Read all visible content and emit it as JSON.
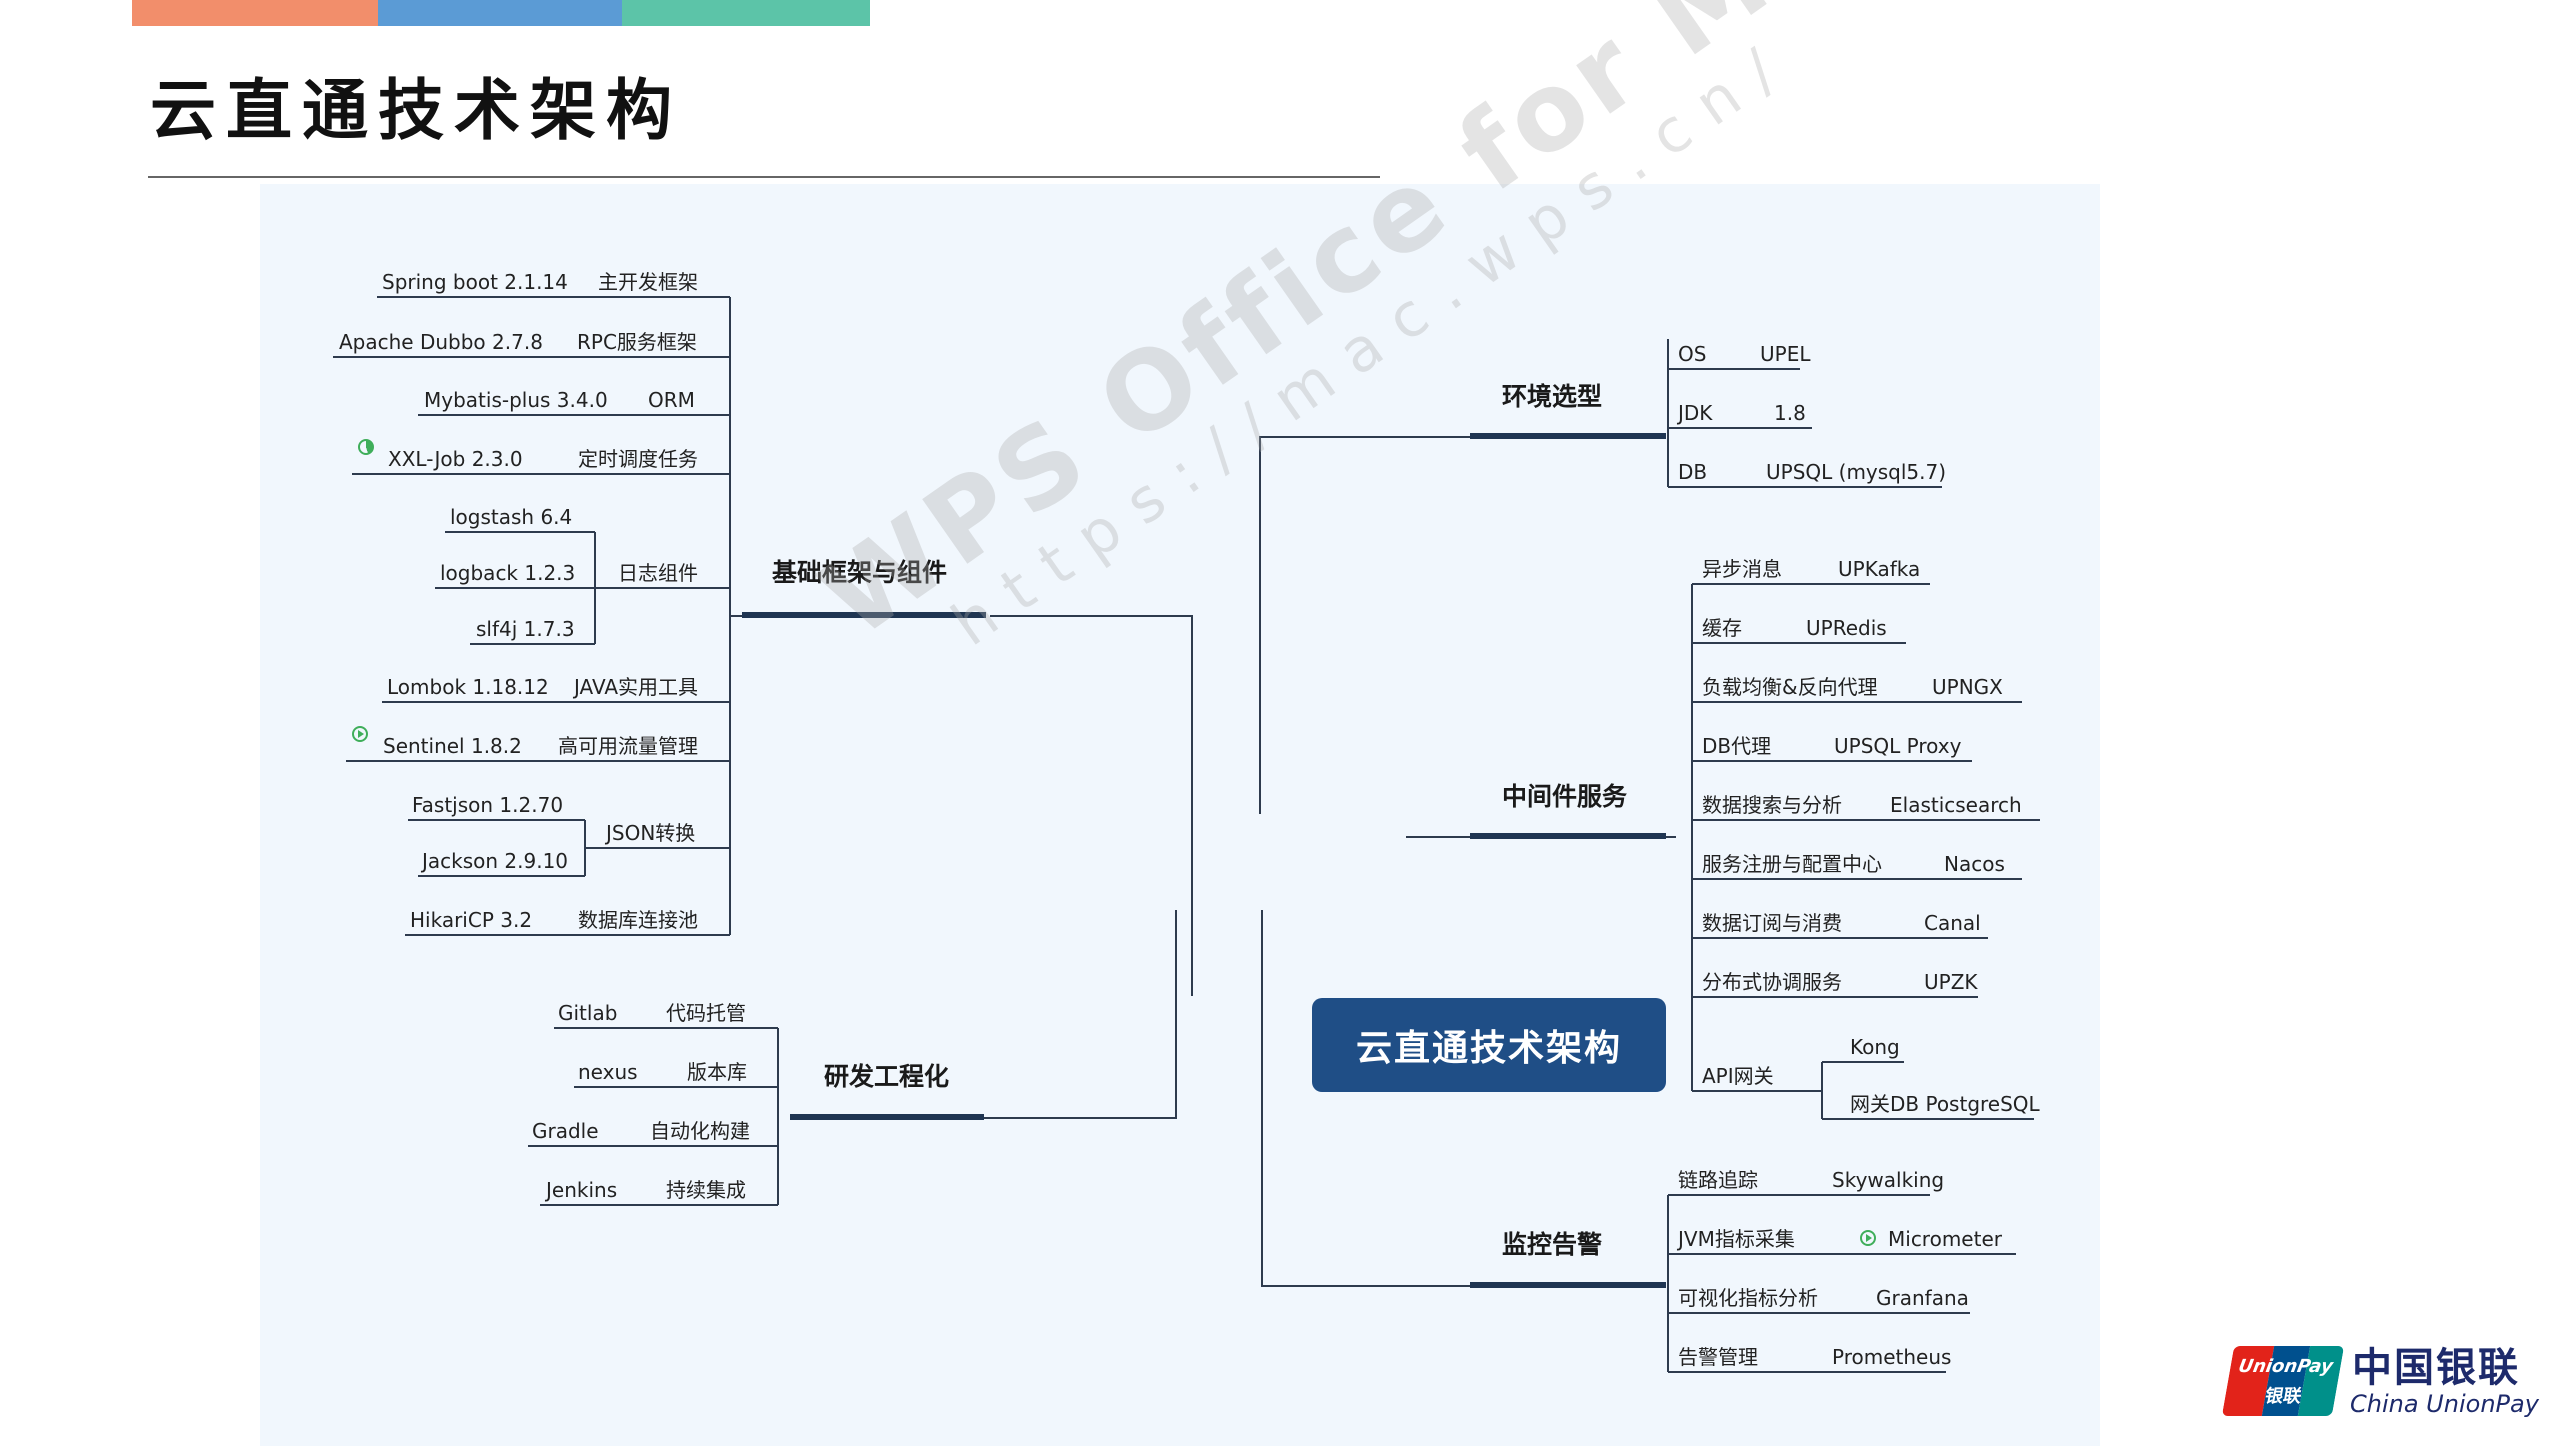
{
  "slide": {
    "title": "云直通技术架构",
    "accent_colors": [
      "#f28e6b",
      "#5b9bd5",
      "#5cc4a8"
    ]
  },
  "mindmap": {
    "center": "云直通技术架构",
    "branches": {
      "base": {
        "label": "基础框架与组件",
        "items": [
          {
            "name": "Spring boot 2.1.14",
            "desc": "主开发框架"
          },
          {
            "name": "Apache Dubbo 2.7.8",
            "desc": "RPC服务框架"
          },
          {
            "name": "Mybatis-plus 3.4.0",
            "desc": "ORM"
          },
          {
            "name": "XXL-Job 2.3.0",
            "desc": "定时调度任务",
            "icon": "progress-icon"
          },
          {
            "name": "Lombok 1.18.12",
            "desc": "JAVA实用工具"
          },
          {
            "name": "Sentinel 1.8.2",
            "desc": "高可用流量管理",
            "icon": "play-icon"
          },
          {
            "name": "HikariCP 3.2",
            "desc": "数据库连接池"
          }
        ],
        "log_group": {
          "label": "日志组件",
          "items": [
            "logstash 6.4",
            "logback 1.2.3",
            "slf4j 1.7.3"
          ]
        },
        "json_group": {
          "label": "JSON转换",
          "items": [
            "Fastjson 1.2.70",
            "Jackson 2.9.10"
          ]
        }
      },
      "devops": {
        "label": "研发工程化",
        "items": [
          {
            "name": "Gitlab",
            "desc": "代码托管"
          },
          {
            "name": "nexus",
            "desc": "版本库"
          },
          {
            "name": "Gradle",
            "desc": "自动化构建"
          },
          {
            "name": "Jenkins",
            "desc": "持续集成"
          }
        ]
      },
      "env": {
        "label": "环境选型",
        "items": [
          {
            "key": "OS",
            "value": "UPEL"
          },
          {
            "key": "JDK",
            "value": "1.8"
          },
          {
            "key": "DB",
            "value": "UPSQL (mysql5.7)"
          }
        ]
      },
      "middleware": {
        "label": "中间件服务",
        "items": [
          {
            "key": "异步消息",
            "value": "UPKafka"
          },
          {
            "key": "缓存",
            "value": "UPRedis"
          },
          {
            "key": "负载均衡&反向代理",
            "value": "UPNGX"
          },
          {
            "key": "DB代理",
            "value": "UPSQL Proxy"
          },
          {
            "key": "数据搜索与分析",
            "value": "Elasticsearch"
          },
          {
            "key": "服务注册与配置中心",
            "value": "Nacos"
          },
          {
            "key": "数据订阅与消费",
            "value": "Canal"
          },
          {
            "key": "分布式协调服务",
            "value": "UPZK"
          }
        ],
        "api_group": {
          "label": "API网关",
          "items": [
            "Kong",
            "网关DB PostgreSQL"
          ]
        }
      },
      "monitor": {
        "label": "监控告警",
        "items": [
          {
            "key": "链路追踪",
            "value": "Skywalking"
          },
          {
            "key": "JVM指标采集",
            "value": "Micrometer",
            "icon": "play-icon"
          },
          {
            "key": "可视化指标分析",
            "value": "Granfana"
          },
          {
            "key": "告警管理",
            "value": "Prometheus"
          }
        ]
      }
    }
  },
  "watermark": {
    "line1": "WPS Office for Mac",
    "line2": "https://mac.wps.cn/"
  },
  "logo": {
    "card_text": "UnionPay",
    "card_text_cn": "银联",
    "cn": "中国银联",
    "en": "China UnionPay"
  }
}
